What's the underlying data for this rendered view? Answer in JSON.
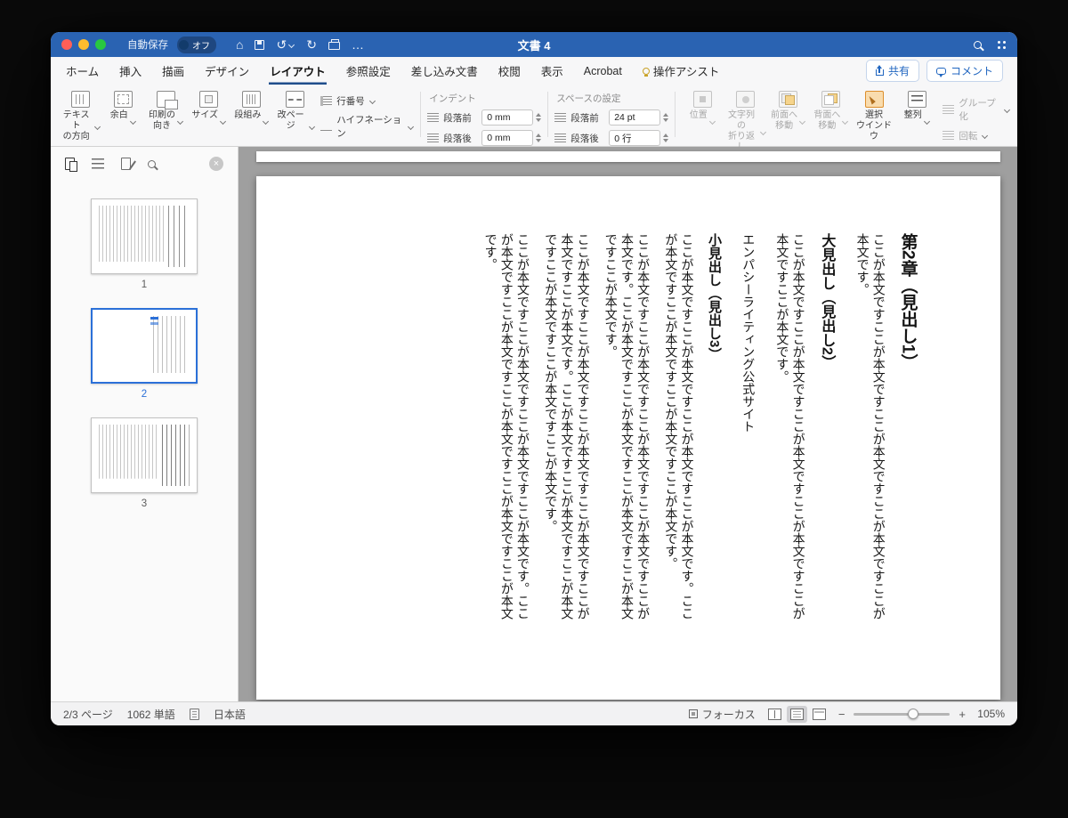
{
  "titlebar": {
    "autosave_label": "自動保存",
    "autosave_state": "オフ",
    "title": "文書 4"
  },
  "icons": {
    "home": "⌂",
    "undo": "↺",
    "redo": "↻",
    "more": "…",
    "close": "×",
    "minus": "−",
    "plus": "+"
  },
  "tabs": [
    {
      "label": "ホーム"
    },
    {
      "label": "挿入"
    },
    {
      "label": "描画"
    },
    {
      "label": "デザイン"
    },
    {
      "label": "レイアウト"
    },
    {
      "label": "参照設定"
    },
    {
      "label": "差し込み文書"
    },
    {
      "label": "校閲"
    },
    {
      "label": "表示"
    },
    {
      "label": "Acrobat"
    },
    {
      "label": "操作アシスト"
    }
  ],
  "actions": {
    "share": "共有",
    "comments": "コメント"
  },
  "ribbon": {
    "page_setup": {
      "buttons": [
        {
          "line1": "テキスト",
          "line2": "の方向"
        },
        {
          "line1": "余白",
          "line2": ""
        },
        {
          "line1": "印刷の",
          "line2": "向き"
        },
        {
          "line1": "サイズ",
          "line2": ""
        },
        {
          "line1": "段組み",
          "line2": ""
        },
        {
          "line1": "改ページ",
          "line2": ""
        }
      ],
      "small": [
        {
          "label": "行番号"
        },
        {
          "label": "ハイフネーション"
        }
      ]
    },
    "indent": {
      "title": "インデント",
      "rows": [
        {
          "label": "段落前",
          "value": "0 mm"
        },
        {
          "label": "段落後",
          "value": "0 mm"
        }
      ]
    },
    "spacing": {
      "title": "スペースの設定",
      "rows": [
        {
          "label": "段落前",
          "value": "24 pt"
        },
        {
          "label": "段落後",
          "value": "0 行"
        }
      ]
    },
    "arrange": {
      "buttons": [
        {
          "line1": "位置",
          "line2": ""
        },
        {
          "line1": "文字列の",
          "line2": "折り返し"
        },
        {
          "line1": "前面へ",
          "line2": "移動"
        },
        {
          "line1": "背面へ",
          "line2": "移動"
        },
        {
          "line1": "選択",
          "line2": "ウインドウ"
        },
        {
          "line1": "整列",
          "line2": ""
        }
      ],
      "stack": [
        {
          "label": "グループ化"
        },
        {
          "label": "回転"
        }
      ]
    }
  },
  "sidebar": {
    "pages": [
      {
        "num": "1"
      },
      {
        "num": "2"
      },
      {
        "num": "3"
      }
    ]
  },
  "doc": {
    "blocks": [
      {
        "type": "h1",
        "text": "第2章（見出し1）"
      },
      {
        "type": "p",
        "text": "ここが本文ですここが本文ですここが本文ですここが本文ですここが本文です。"
      },
      {
        "type": "h2",
        "text": "大見出し（見出し2）"
      },
      {
        "type": "p",
        "text": "ここが本文ですここが本文ですここが本文ですここが本文ですここが本文ですここが本文です。"
      },
      {
        "type": "p-sans",
        "text": "エンパシーライティング公式サイト"
      },
      {
        "type": "h3",
        "text": "小見出し（見出し3）"
      },
      {
        "type": "p",
        "text": "ここが本文ですここが本文ですここが本文ですここが本文です。ここが本文ですここが本文ですここが本文ですここが本文です。"
      },
      {
        "type": "p",
        "text": "ここが本文ですここが本文ですここが本文ですここが本文ですここが本文です。ここが本文ですここが本文ですここが本文ですここが本文ですここが本文です。"
      },
      {
        "type": "p",
        "text": "ここが本文ですここが本文ですここが本文ですここが本文ですここが本文ですここが本文です。ここが本文ですここが本文ですここが本文ですここが本文ですここが本文ですここが本文です。"
      },
      {
        "type": "p",
        "text": "ここが本文ですここが本文ですここが本文ですここが本文です。ここが本文ですここが本文ですここが本文ですここが本文ですここが本文です。"
      }
    ]
  },
  "statusbar": {
    "page": "2/3 ページ",
    "words": "1062 単語",
    "lang": "日本語",
    "focus": "フォーカス",
    "zoom": "105%"
  }
}
